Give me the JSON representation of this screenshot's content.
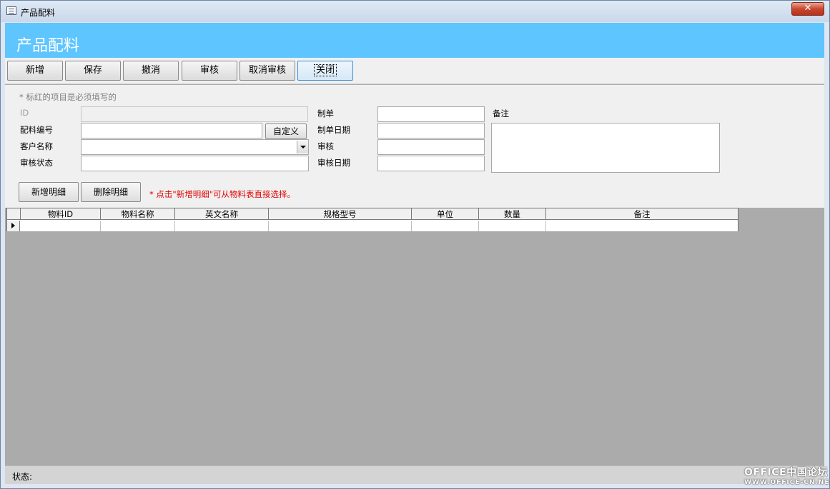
{
  "window": {
    "title": "产品配料",
    "close_glyph": "✕"
  },
  "header": {
    "title": "产品配料"
  },
  "toolbar": {
    "buttons": [
      {
        "label": "新增"
      },
      {
        "label": "保存"
      },
      {
        "label": "撤消"
      },
      {
        "label": "审核"
      },
      {
        "label": "取消审核"
      },
      {
        "label": "关闭"
      }
    ]
  },
  "form": {
    "hint": "* 标红的项目是必须填写的",
    "id_label": "ID",
    "code_label": "配料编号",
    "custom_button": "自定义",
    "customer_label": "客户名称",
    "audit_status_label": "审核状态",
    "maker_label": "制单",
    "make_date_label": "制单日期",
    "auditor_label": "审核",
    "audit_date_label": "审核日期",
    "remarks_label": "备注",
    "add_detail_button": "新增明细",
    "delete_detail_button": "删除明细",
    "detail_note": "* 点击\"新增明细\"可从物料表直接选择。"
  },
  "grid": {
    "columns": [
      "物料ID",
      "物料名称",
      "英文名称",
      "规格型号",
      "单位",
      "数量",
      "备注"
    ]
  },
  "status": {
    "label": "状态:"
  },
  "watermark": {
    "line1": "OFFICE中国论坛",
    "line2": "WWW.OFFICE-CN.NET"
  }
}
